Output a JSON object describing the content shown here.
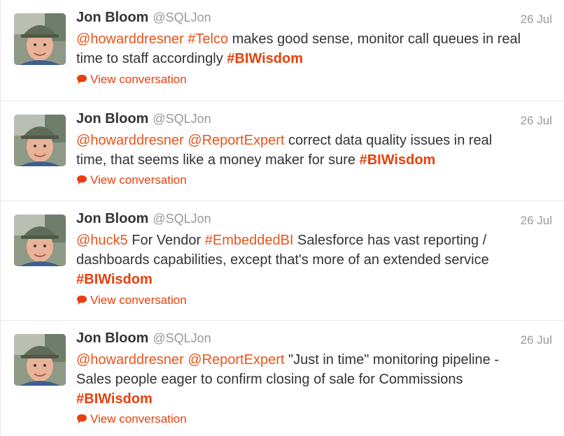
{
  "tweets": [
    {
      "name": "Jon Bloom",
      "handle": "@SQLJon",
      "time": "26 Jul",
      "parts": [
        {
          "t": "mention",
          "v": "@howarddresner"
        },
        {
          "t": "text",
          "v": " "
        },
        {
          "t": "hashtag",
          "v": "#Telco"
        },
        {
          "t": "text",
          "v": " makes good sense, monitor call queues in real time to staff accordingly "
        },
        {
          "t": "hashtag-bold",
          "v": "#BIWisdom"
        }
      ],
      "action": "View conversation"
    },
    {
      "name": "Jon Bloom",
      "handle": "@SQLJon",
      "time": "26 Jul",
      "parts": [
        {
          "t": "mention",
          "v": "@howarddresner"
        },
        {
          "t": "text",
          "v": " "
        },
        {
          "t": "mention",
          "v": "@ReportExpert"
        },
        {
          "t": "text",
          "v": " correct data quality issues in real time, that seems like a money maker for sure "
        },
        {
          "t": "hashtag-bold",
          "v": "#BIWisdom"
        }
      ],
      "action": "View conversation"
    },
    {
      "name": "Jon Bloom",
      "handle": "@SQLJon",
      "time": "26 Jul",
      "parts": [
        {
          "t": "mention",
          "v": "@huck5"
        },
        {
          "t": "text",
          "v": " For Vendor "
        },
        {
          "t": "hashtag",
          "v": "#EmbeddedBI"
        },
        {
          "t": "text",
          "v": " Salesforce has vast reporting / dashboards capabilities, except that's more of an extended service "
        },
        {
          "t": "hashtag-bold",
          "v": "#BIWisdom"
        }
      ],
      "action": "View conversation"
    },
    {
      "name": "Jon Bloom",
      "handle": "@SQLJon",
      "time": "26 Jul",
      "parts": [
        {
          "t": "mention",
          "v": "@howarddresner"
        },
        {
          "t": "text",
          "v": " "
        },
        {
          "t": "mention",
          "v": "@ReportExpert"
        },
        {
          "t": "text",
          "v": " \"Just in time\" monitoring pipeline - Sales people eager to confirm closing of sale for Commissions  "
        },
        {
          "t": "hashtag-bold",
          "v": "#BIWisdom"
        }
      ],
      "action": "View conversation"
    }
  ],
  "icons": {
    "conversation": "speech-bubble-icon",
    "accent": "#e8400c"
  }
}
